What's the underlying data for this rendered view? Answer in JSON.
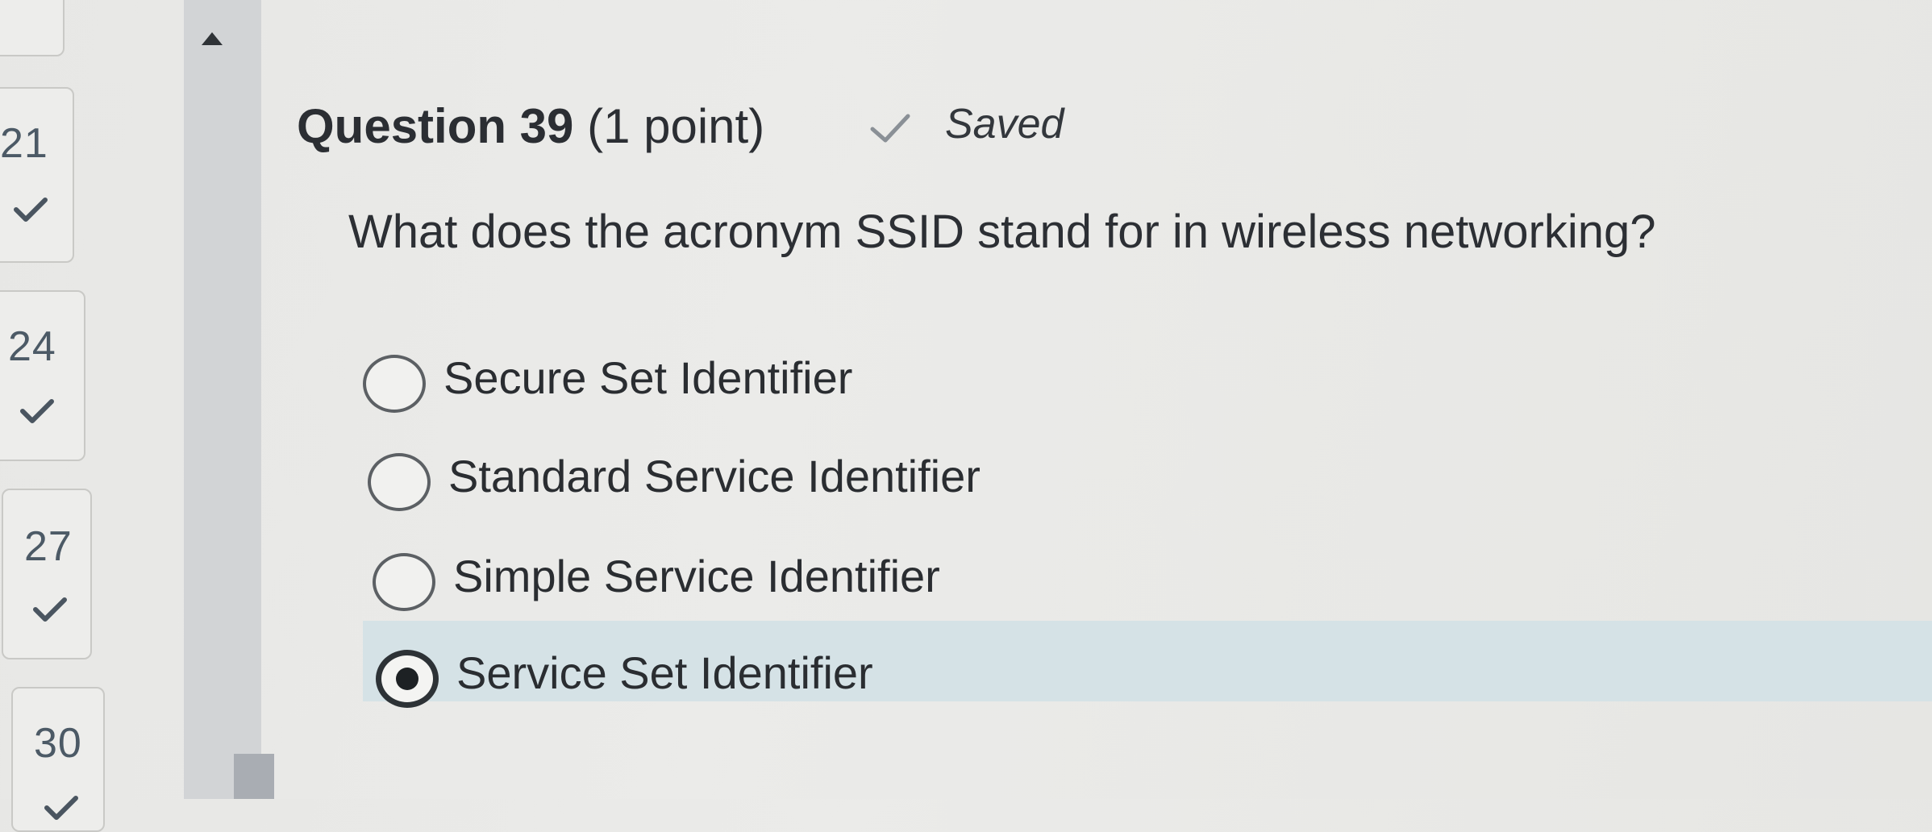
{
  "nav": {
    "items": [
      {
        "number": "21",
        "answered": true
      },
      {
        "number": "24",
        "answered": true
      },
      {
        "number": "27",
        "answered": true
      },
      {
        "number": "30",
        "answered": true
      }
    ]
  },
  "question": {
    "title": "Question 39",
    "points": "(1 point)",
    "status": "Saved",
    "text": "What does the acronym SSID stand for in wireless networking?",
    "options": [
      {
        "label": "Secure Set Identifier",
        "selected": false
      },
      {
        "label": "Standard Service Identifier",
        "selected": false
      },
      {
        "label": "Simple Service Identifier",
        "selected": false
      },
      {
        "label": "Service Set Identifier",
        "selected": true
      }
    ]
  },
  "colors": {
    "selected_highlight": "#d5e2e6",
    "check_color": "#4a5560",
    "scrollbar_track": "#d2d4d6"
  },
  "icons": {
    "nav_answered": "checkmark-icon",
    "saved": "checkmark-icon",
    "scroll_up": "triangle-up-icon"
  }
}
